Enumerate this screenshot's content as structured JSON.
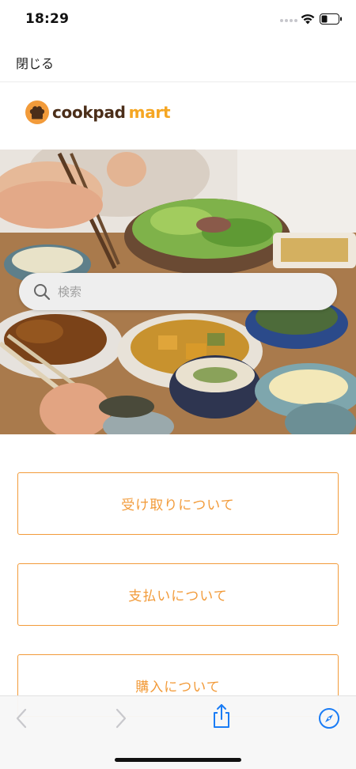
{
  "status_bar": {
    "time": "18:29"
  },
  "header": {
    "close_label": "閉じる"
  },
  "logo": {
    "word1": "cookpad",
    "word2": "mart",
    "colors": {
      "brown": "#4b2e19",
      "orange": "#f5a623"
    }
  },
  "search": {
    "placeholder": "検索"
  },
  "menu": {
    "items": [
      {
        "label": "受け取りについて"
      },
      {
        "label": "支払いについて"
      },
      {
        "label": "購入について"
      }
    ],
    "accent_color": "#f29b3a"
  },
  "toolbar": {
    "icons": [
      "back-icon",
      "forward-icon",
      "share-icon",
      "compass-icon"
    ],
    "accent_color": "#1a7cf5"
  }
}
